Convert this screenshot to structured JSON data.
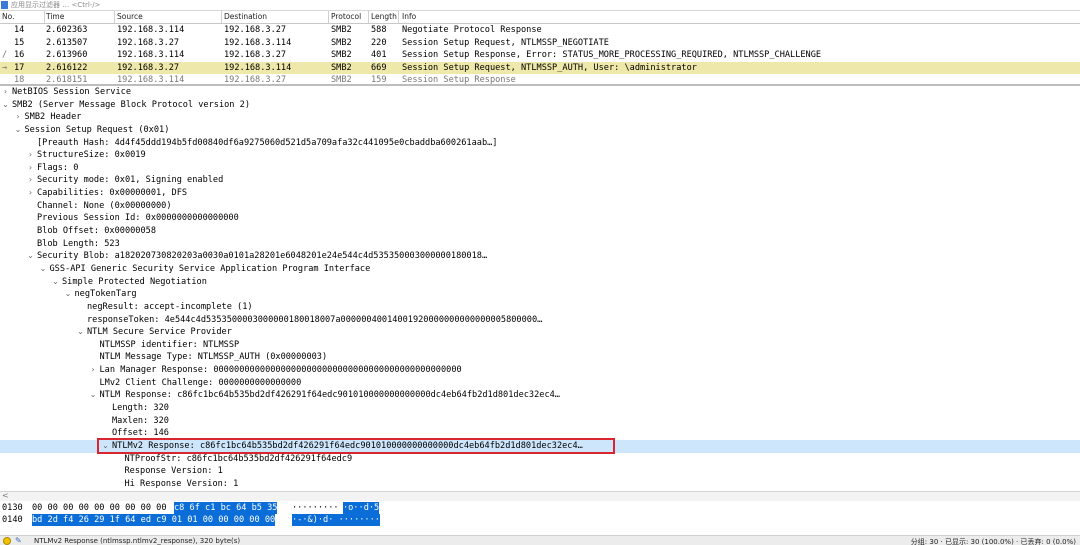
{
  "filter_bar": {
    "placeholder": "应用显示过滤器 … <Ctrl-/>"
  },
  "packet_list": {
    "columns": [
      "No.",
      "Time",
      "Source",
      "Destination",
      "Protocol",
      "Length",
      "Info"
    ],
    "rows": [
      {
        "no": "14",
        "time": "2.602363",
        "src": "192.168.3.114",
        "dst": "192.168.3.27",
        "proto": "SMB2",
        "len": "588",
        "info": "Negotiate Protocol Response",
        "marker": ""
      },
      {
        "no": "15",
        "time": "2.613507",
        "src": "192.168.3.27",
        "dst": "192.168.3.114",
        "proto": "SMB2",
        "len": "220",
        "info": "Session Setup Request, NTLMSSP_NEGOTIATE",
        "marker": ""
      },
      {
        "no": "16",
        "time": "2.613960",
        "src": "192.168.3.114",
        "dst": "192.168.3.27",
        "proto": "SMB2",
        "len": "401",
        "info": "Session Setup Response, Error: STATUS_MORE_PROCESSING_REQUIRED, NTLMSSP_CHALLENGE",
        "marker": "/"
      },
      {
        "no": "17",
        "time": "2.616122",
        "src": "192.168.3.27",
        "dst": "192.168.3.114",
        "proto": "SMB2",
        "len": "669",
        "info": "Session Setup Request, NTLMSSP_AUTH, User: \\administrator",
        "marker": "→"
      },
      {
        "no": "18",
        "time": "2.618151",
        "src": "192.168.3.114",
        "dst": "192.168.3.27",
        "proto": "SMB2",
        "len": "159",
        "info": "Session Setup Response",
        "marker": ""
      }
    ]
  },
  "tree": [
    {
      "level": 0,
      "arrow": ">",
      "text": "NetBIOS Session Service"
    },
    {
      "level": 0,
      "arrow": "v",
      "text": "SMB2 (Server Message Block Protocol version 2)"
    },
    {
      "level": 1,
      "arrow": ">",
      "text": "SMB2 Header"
    },
    {
      "level": 1,
      "arrow": "v",
      "text": "Session Setup Request (0x01)"
    },
    {
      "level": 2,
      "arrow": "",
      "text": "[Preauth Hash: 4d4f45ddd194b5fd00840df6a9275060d521d5a709afa32c441095e0cbaddba600261aab…]"
    },
    {
      "level": 2,
      "arrow": ">",
      "text": "StructureSize: 0x0019"
    },
    {
      "level": 2,
      "arrow": ">",
      "text": "Flags: 0"
    },
    {
      "level": 2,
      "arrow": ">",
      "text": "Security mode: 0x01, Signing enabled"
    },
    {
      "level": 2,
      "arrow": ">",
      "text": "Capabilities: 0x00000001, DFS"
    },
    {
      "level": 2,
      "arrow": "",
      "text": "Channel: None (0x00000000)"
    },
    {
      "level": 2,
      "arrow": "",
      "text": "Previous Session Id: 0x0000000000000000"
    },
    {
      "level": 2,
      "arrow": "",
      "text": "Blob Offset: 0x00000058"
    },
    {
      "level": 2,
      "arrow": "",
      "text": "Blob Length: 523"
    },
    {
      "level": 2,
      "arrow": "v",
      "text": "Security Blob: a182020730820203a0030a0101a28201e6048201e24e544c4d535350003000000180018…"
    },
    {
      "level": 3,
      "arrow": "v",
      "text": "GSS-API Generic Security Service Application Program Interface"
    },
    {
      "level": 4,
      "arrow": "v",
      "text": "Simple Protected Negotiation"
    },
    {
      "level": 5,
      "arrow": "v",
      "text": "negTokenTarg"
    },
    {
      "level": 6,
      "arrow": "",
      "text": "negResult: accept-incomplete (1)"
    },
    {
      "level": 6,
      "arrow": "",
      "text": "responseToken: 4e544c4d5353500003000000180018007a00000040014001920000000000000005800000…"
    },
    {
      "level": 6,
      "arrow": "v",
      "text": "NTLM Secure Service Provider"
    },
    {
      "level": 7,
      "arrow": "",
      "text": "NTLMSSP identifier: NTLMSSP"
    },
    {
      "level": 7,
      "arrow": "",
      "text": "NTLM Message Type: NTLMSSP_AUTH (0x00000003)"
    },
    {
      "level": 7,
      "arrow": ">",
      "text": "Lan Manager Response: 000000000000000000000000000000000000000000000000"
    },
    {
      "level": 7,
      "arrow": "",
      "text": "LMv2 Client Challenge: 0000000000000000"
    },
    {
      "level": 7,
      "arrow": "v",
      "text": "NTLM Response: c86fc1bc64b535bd2df426291f64edc901010000000000000dc4eb64fb2d1d801dec32ec4…"
    },
    {
      "level": 8,
      "arrow": "",
      "text": "Length: 320"
    },
    {
      "level": 8,
      "arrow": "",
      "text": "Maxlen: 320"
    },
    {
      "level": 8,
      "arrow": "",
      "text": "Offset: 146"
    },
    {
      "level": 8,
      "arrow": "v",
      "text": "NTLMv2 Response: c86fc1bc64b535bd2df426291f64edc901010000000000000dc4eb64fb2d1d801dec32ec4…",
      "highlight": true
    },
    {
      "level": 9,
      "arrow": "",
      "text": "NTProofStr: c86fc1bc64b535bd2df426291f64edc9"
    },
    {
      "level": 9,
      "arrow": "",
      "text": "Response Version: 1"
    },
    {
      "level": 9,
      "arrow": "",
      "text": "Hi Response Version: 1"
    }
  ],
  "scroll_indicator": "<",
  "hex": [
    {
      "offset": "0130",
      "plain": "00 00 00 00 00 00 00 00  00 ",
      "sel": "c8 6f c1 bc 64 b5 35",
      "ascii_plain": "·········",
      "ascii_sel": "·o··d·5"
    },
    {
      "offset": "0140",
      "plain": "",
      "sel": "bd 2d f4 26 29 1f 64 ed  c9 01 01 00 00 00 00 00",
      "ascii_plain": "",
      "ascii_sel": "·-·&)·d· ········"
    }
  ],
  "status_bar": {
    "left": "NTLMv2 Response (ntlmssp.ntlmv2_response), 320 byte(s)",
    "right": "分组: 30 · 已显示: 30 (100.0%) · 已丢弃: 0 (0.0%)"
  },
  "colors": {
    "selected_row": "#eee8aa",
    "tree_highlight": "#cde6fb",
    "hex_selection": "#0a6dd8",
    "annotation_box": "#d9262e"
  }
}
